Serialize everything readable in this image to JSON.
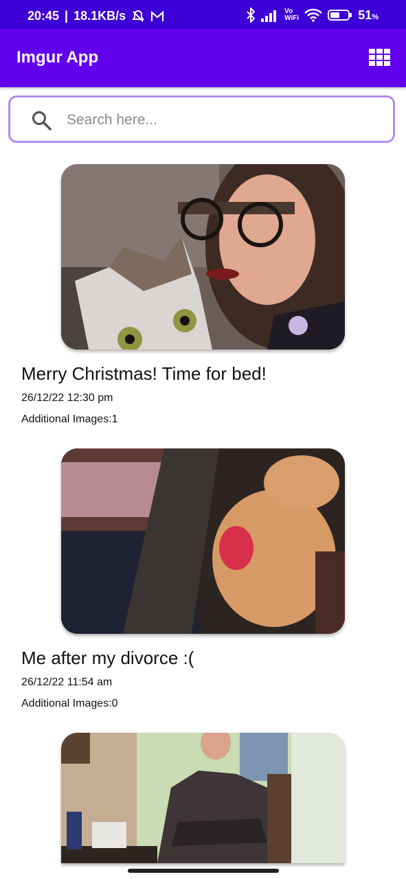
{
  "status_bar": {
    "time": "20:45",
    "separator": "|",
    "speed": "18.1KB/s",
    "vo_wifi_top": "Vo",
    "vo_wifi_bottom": "WiFi",
    "battery": "51",
    "battery_unit": "%"
  },
  "app_bar": {
    "title": "Imgur App",
    "grid_icon": "grid-icon"
  },
  "search": {
    "placeholder": "Search here...",
    "value": "",
    "icon": "search-icon"
  },
  "posts": [
    {
      "title": "Merry Christmas! Time for bed!",
      "date": "26/12/22 12:30 pm",
      "additional_label": "Additional Images:",
      "additional_count": "1"
    },
    {
      "title": "Me after my divorce :(",
      "date": "26/12/22 11:54 am",
      "additional_label": "Additional Images:",
      "additional_count": "0"
    },
    {
      "title": "",
      "date": "",
      "additional_label": "",
      "additional_count": ""
    }
  ],
  "colors": {
    "status_bar": "#3d00d6",
    "app_bar": "#6200ee",
    "search_border": "#b48be8"
  }
}
